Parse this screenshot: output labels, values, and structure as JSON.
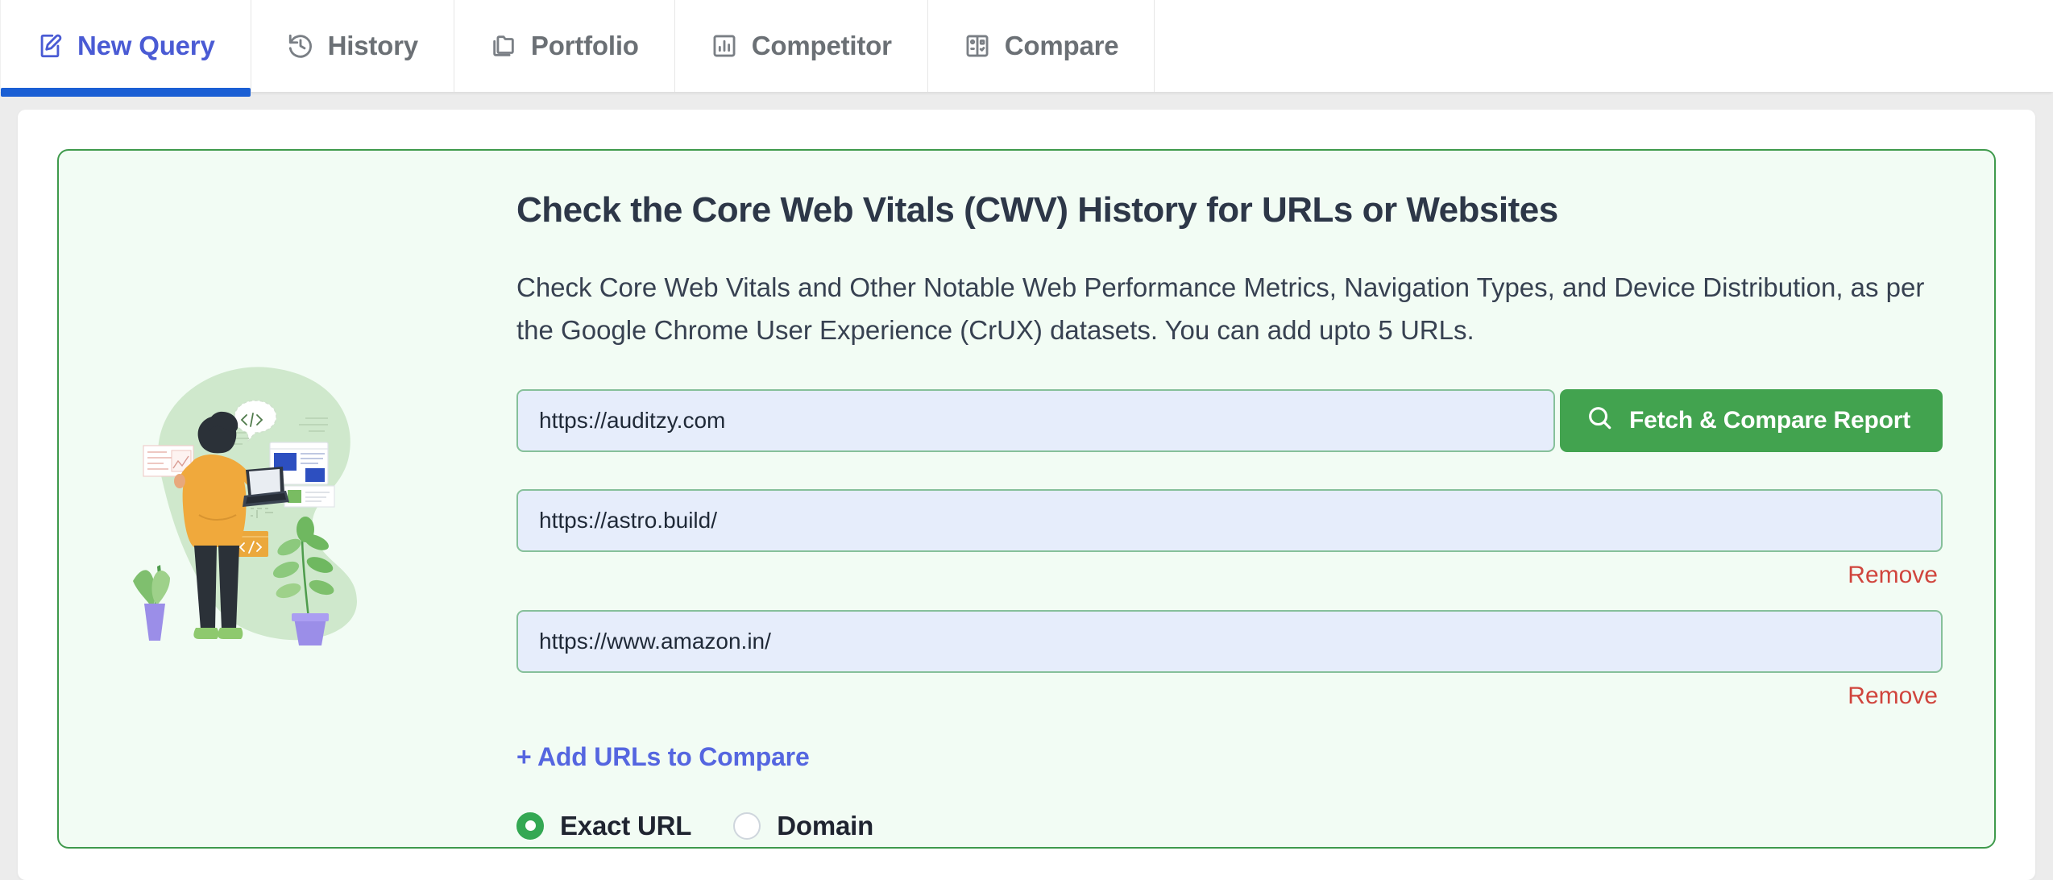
{
  "tabs": [
    {
      "label": "New Query",
      "icon": "file-edit-icon",
      "active": true
    },
    {
      "label": "History",
      "icon": "clock-rotate-icon",
      "active": false
    },
    {
      "label": "Portfolio",
      "icon": "folder-copy-icon",
      "active": false
    },
    {
      "label": "Competitor",
      "icon": "bar-chart-icon",
      "active": false
    },
    {
      "label": "Compare",
      "icon": "compare-table-icon",
      "active": false
    }
  ],
  "card": {
    "headline": "Check the Core Web Vitals (CWV) History for URLs or Websites",
    "description": "Check Core Web Vitals and Other Notable Web Performance Metrics, Navigation Types, and Device Distribution, as per the Google Chrome User Experience (CrUX) datasets. You can add upto 5 URLs.",
    "urls": [
      {
        "value": "https://auditzy.com",
        "placeholder": "Enter URL",
        "removable": false
      },
      {
        "value": "https://astro.build/",
        "placeholder": "Enter URL",
        "removable": true
      },
      {
        "value": "https://www.amazon.in/",
        "placeholder": "Enter URL",
        "removable": true
      }
    ],
    "remove_label": "Remove",
    "fetch_button": "Fetch & Compare Report",
    "fetch_button_icon": "search-icon",
    "add_urls_label": "+ Add URLs to Compare",
    "scope_options": [
      {
        "label": "Exact URL",
        "selected": true
      },
      {
        "label": "Domain",
        "selected": false
      }
    ]
  },
  "colors": {
    "accent_blue": "#4a5bd4",
    "tab_indicator": "#1b5fd4",
    "green_button": "#42a34f",
    "card_border": "#3f9a4c",
    "card_bg": "#f2fcf4",
    "input_bg": "#e6edfb",
    "input_border": "#86c09a",
    "remove_red": "#d0453d",
    "radio_on": "#34a853"
  }
}
